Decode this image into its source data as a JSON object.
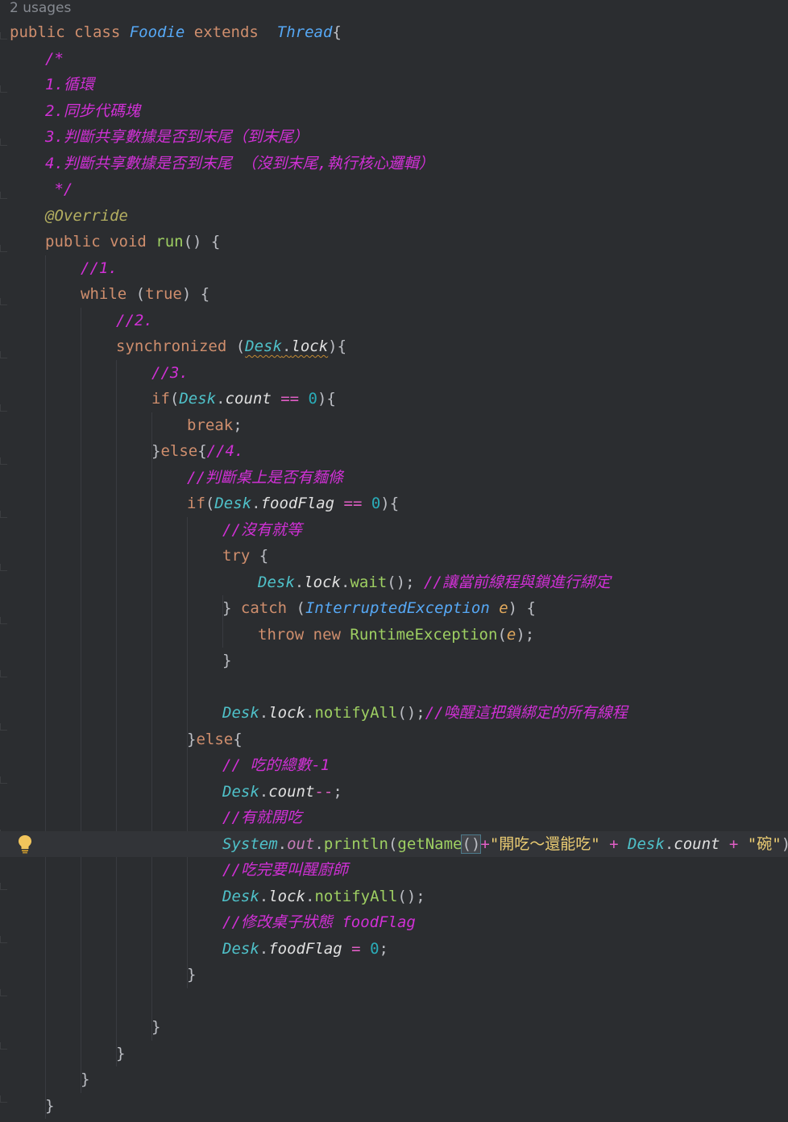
{
  "editor": {
    "usages_hint": "2 usages",
    "lines": [
      {
        "t": [
          [
            "kw",
            "public "
          ],
          [
            "kw",
            "class "
          ],
          [
            "type",
            "Foodie "
          ],
          [
            "kw",
            "extends  "
          ],
          [
            "type",
            "Thread"
          ],
          [
            "p",
            "{"
          ]
        ]
      },
      {
        "i": 1,
        "t": [
          [
            "cmt",
            "/*"
          ]
        ]
      },
      {
        "i": 1,
        "t": [
          [
            "cmt",
            "1.循環"
          ]
        ]
      },
      {
        "i": 1,
        "t": [
          [
            "cmt",
            "2.同步代碼塊"
          ]
        ]
      },
      {
        "i": 1,
        "t": [
          [
            "cmt",
            "3.判斷共享數據是否到末尾（到末尾）"
          ]
        ]
      },
      {
        "i": 1,
        "t": [
          [
            "cmt",
            "4.判斷共享數據是否到末尾 （沒到末尾,執行核心邏輯）"
          ]
        ]
      },
      {
        "i": 1,
        "t": [
          [
            "cmt",
            " */"
          ]
        ]
      },
      {
        "i": 1,
        "t": [
          [
            "ann",
            "@Override"
          ]
        ]
      },
      {
        "i": 1,
        "t": [
          [
            "kw",
            "public "
          ],
          [
            "kw",
            "void "
          ],
          [
            "meth",
            "run"
          ],
          [
            "p",
            "() {"
          ]
        ]
      },
      {
        "i": 2,
        "t": [
          [
            "cmt",
            "//1."
          ]
        ]
      },
      {
        "i": 2,
        "t": [
          [
            "kw",
            "while "
          ],
          [
            "p",
            "("
          ],
          [
            "kw",
            "true"
          ],
          [
            "p",
            ") {"
          ]
        ]
      },
      {
        "i": 3,
        "t": [
          [
            "cmt",
            "//2."
          ]
        ]
      },
      {
        "i": 3,
        "t": [
          [
            "kw",
            "synchronized "
          ],
          [
            "p",
            "("
          ],
          [
            "squigcls",
            "Desk"
          ],
          [
            "squigp",
            "."
          ],
          [
            "squigfld",
            "lock"
          ],
          [
            "p",
            ")"
          ],
          [
            "p",
            "{"
          ]
        ]
      },
      {
        "i": 4,
        "t": [
          [
            "cmt",
            "//3."
          ]
        ]
      },
      {
        "i": 4,
        "t": [
          [
            "kw",
            "if"
          ],
          [
            "p",
            "("
          ],
          [
            "cls2",
            "Desk"
          ],
          [
            "p",
            "."
          ],
          [
            "fld2",
            "count"
          ],
          [
            "op",
            " == "
          ],
          [
            "num",
            "0"
          ],
          [
            "p",
            "){"
          ]
        ]
      },
      {
        "i": 5,
        "t": [
          [
            "kw",
            "break"
          ],
          [
            "p",
            ";"
          ]
        ]
      },
      {
        "i": 4,
        "t": [
          [
            "p",
            "}"
          ],
          [
            "kw",
            "else"
          ],
          [
            "p",
            "{"
          ],
          [
            "cmt",
            "//4."
          ]
        ]
      },
      {
        "i": 5,
        "t": [
          [
            "cmt",
            "//判斷桌上是否有麵條"
          ]
        ]
      },
      {
        "i": 5,
        "t": [
          [
            "kw",
            "if"
          ],
          [
            "p",
            "("
          ],
          [
            "cls2",
            "Desk"
          ],
          [
            "p",
            "."
          ],
          [
            "fld2",
            "foodFlag"
          ],
          [
            "op",
            " == "
          ],
          [
            "num",
            "0"
          ],
          [
            "p",
            "){"
          ]
        ]
      },
      {
        "i": 6,
        "t": [
          [
            "cmt",
            "//沒有就等"
          ]
        ]
      },
      {
        "i": 6,
        "t": [
          [
            "kw",
            "try "
          ],
          [
            "p",
            "{"
          ]
        ]
      },
      {
        "i": 7,
        "t": [
          [
            "cls2",
            "Desk"
          ],
          [
            "p",
            "."
          ],
          [
            "fld2",
            "lock"
          ],
          [
            "p",
            "."
          ],
          [
            "meth",
            "wait"
          ],
          [
            "p",
            "(); "
          ],
          [
            "cmt",
            "//讓當前線程與鎖進行綁定"
          ]
        ]
      },
      {
        "i": 6,
        "t": [
          [
            "p",
            "} "
          ],
          [
            "kw",
            "catch "
          ],
          [
            "p",
            "("
          ],
          [
            "type",
            "InterruptedException "
          ],
          [
            "par",
            "e"
          ],
          [
            "p",
            ") {"
          ]
        ]
      },
      {
        "i": 7,
        "t": [
          [
            "kw",
            "throw "
          ],
          [
            "kw",
            "new "
          ],
          [
            "meth",
            "RuntimeException"
          ],
          [
            "p",
            "("
          ],
          [
            "par",
            "e"
          ],
          [
            "p",
            ");"
          ]
        ]
      },
      {
        "i": 6,
        "t": [
          [
            "p",
            "}"
          ]
        ]
      },
      {
        "i": 6,
        "t": []
      },
      {
        "i": 6,
        "t": [
          [
            "cls2",
            "Desk"
          ],
          [
            "p",
            "."
          ],
          [
            "fld2",
            "lock"
          ],
          [
            "p",
            "."
          ],
          [
            "meth",
            "notifyAll"
          ],
          [
            "p",
            "();"
          ],
          [
            "cmt",
            "//喚醒這把鎖綁定的所有線程"
          ]
        ]
      },
      {
        "i": 5,
        "t": [
          [
            "p",
            "}"
          ],
          [
            "kw",
            "else"
          ],
          [
            "p",
            "{"
          ]
        ]
      },
      {
        "i": 6,
        "t": [
          [
            "cmt",
            "// 吃的總數-1"
          ]
        ]
      },
      {
        "i": 6,
        "t": [
          [
            "cls2",
            "Desk"
          ],
          [
            "p",
            "."
          ],
          [
            "fld2",
            "count"
          ],
          [
            "op",
            "--"
          ],
          [
            "p",
            ";"
          ]
        ]
      },
      {
        "i": 6,
        "t": [
          [
            "cmt",
            "//有就開吃"
          ]
        ]
      },
      {
        "i": 6,
        "current": true,
        "t": [
          [
            "cls2",
            "System"
          ],
          [
            "p",
            "."
          ],
          [
            "fld",
            "out"
          ],
          [
            "p",
            "."
          ],
          [
            "meth",
            "println"
          ],
          [
            "p",
            "("
          ],
          [
            "meth",
            "getName"
          ],
          [
            "hl",
            "()"
          ],
          [
            "op",
            "+"
          ],
          [
            "str",
            "\"開吃～還能吃\""
          ],
          [
            "op",
            " + "
          ],
          [
            "cls2",
            "Desk"
          ],
          [
            "p",
            "."
          ],
          [
            "fld2",
            "count"
          ],
          [
            "op",
            " + "
          ],
          [
            "str",
            "\"碗\""
          ],
          [
            "p",
            ");"
          ]
        ]
      },
      {
        "i": 6,
        "t": [
          [
            "cmt",
            "//吃完要叫醒廚師"
          ]
        ]
      },
      {
        "i": 6,
        "t": [
          [
            "cls2",
            "Desk"
          ],
          [
            "p",
            "."
          ],
          [
            "fld2",
            "lock"
          ],
          [
            "p",
            "."
          ],
          [
            "meth",
            "notifyAll"
          ],
          [
            "p",
            "();"
          ]
        ]
      },
      {
        "i": 6,
        "t": [
          [
            "cmt",
            "//修改桌子狀態 foodFlag"
          ]
        ]
      },
      {
        "i": 6,
        "t": [
          [
            "cls2",
            "Desk"
          ],
          [
            "p",
            "."
          ],
          [
            "fld2",
            "foodFlag"
          ],
          [
            "op",
            " = "
          ],
          [
            "num",
            "0"
          ],
          [
            "p",
            ";"
          ]
        ]
      },
      {
        "i": 5,
        "t": [
          [
            "p",
            "}"
          ]
        ]
      },
      {
        "i": 5,
        "t": []
      },
      {
        "i": 4,
        "t": [
          [
            "p",
            "}"
          ]
        ]
      },
      {
        "i": 3,
        "t": [
          [
            "p",
            "}"
          ]
        ]
      },
      {
        "i": 2,
        "t": [
          [
            "p",
            "}"
          ]
        ]
      },
      {
        "i": 1,
        "t": [
          [
            "p",
            "}"
          ]
        ]
      }
    ],
    "intention_bulb_icon": "lightbulb-icon"
  }
}
